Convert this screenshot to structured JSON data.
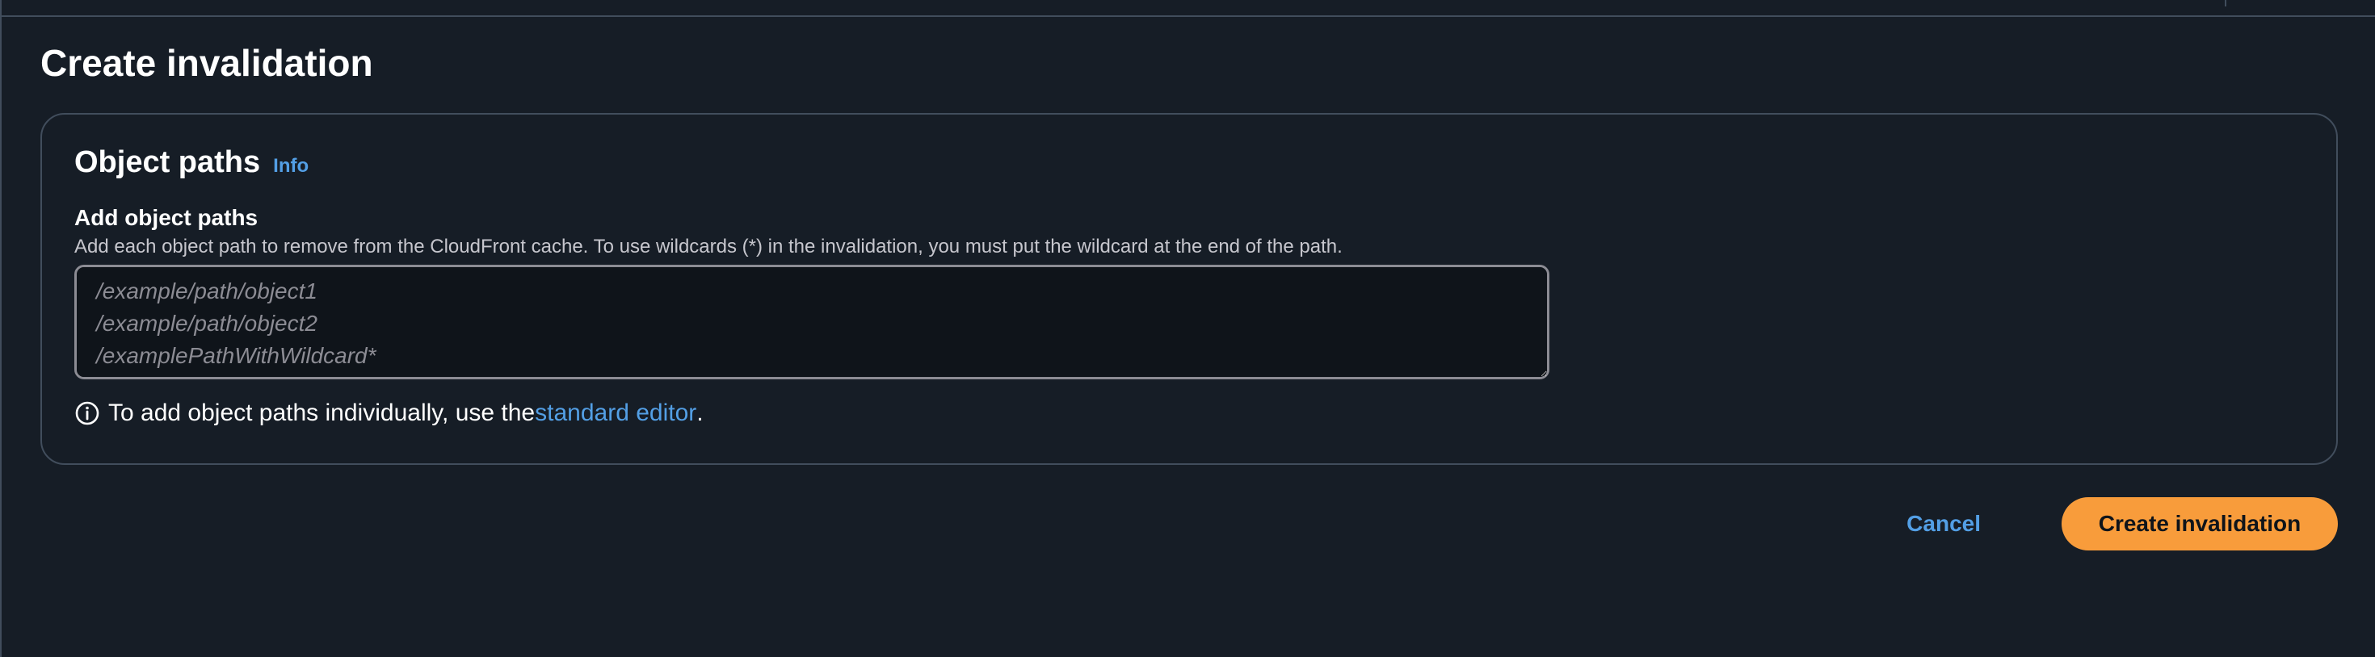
{
  "page": {
    "title": "Create invalidation"
  },
  "object_paths": {
    "title": "Object paths",
    "info_label": "Info",
    "field_label": "Add object paths",
    "field_description": "Add each object path to remove from the CloudFront cache. To use wildcards (*) in the invalidation, you must put the wildcard at the end of the path.",
    "textarea_value": "",
    "textarea_placeholder": "/example/path/object1\n/example/path/object2\n/examplePathWithWildcard*",
    "hint_text": "To add object paths individually, use the ",
    "hint_link": "standard editor",
    "hint_suffix": ".",
    "hint_icon": "info-circle-icon"
  },
  "actions": {
    "cancel_label": "Cancel",
    "create_label": "Create invalidation"
  },
  "colors": {
    "background": "#161d26",
    "border": "#414d5c",
    "link": "#539fe5",
    "primary_button": "#f89c3b",
    "placeholder": "#8c8c94"
  }
}
